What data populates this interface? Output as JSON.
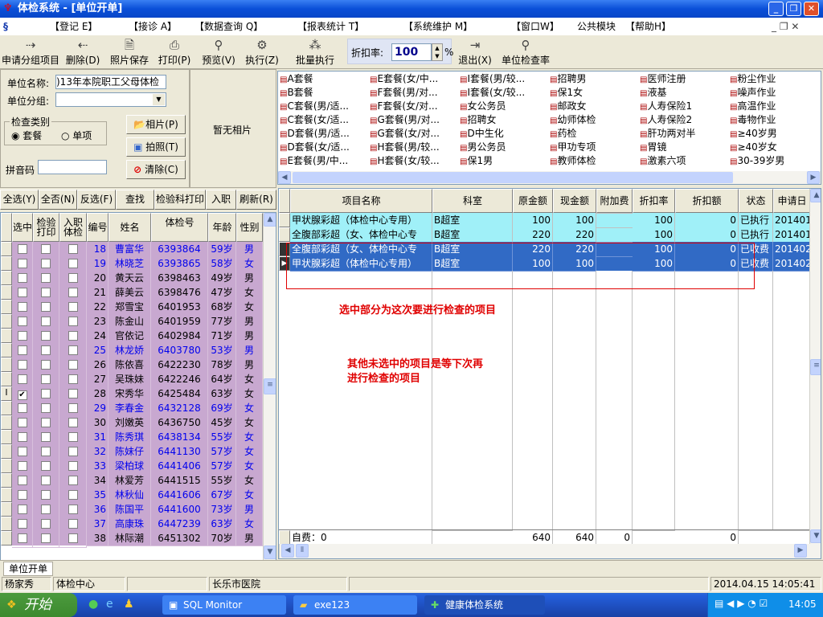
{
  "window": {
    "title": "体检系统 - [单位开单]"
  },
  "menu": [
    "【登记 E】",
    "【接诊 A】",
    "【数据查询 Q】",
    "【报表统计 T】",
    "【系统维护 M】",
    "【窗口W】",
    "公共模块",
    "【帮助H】"
  ],
  "toolbar": {
    "items": [
      {
        "label": "申请分组项目",
        "icon": "add-group-icon"
      },
      {
        "label": "删除(D)",
        "icon": "delete-icon"
      },
      {
        "label": "照片保存",
        "icon": "photo-save-icon"
      },
      {
        "label": "打印(P)",
        "icon": "printer-icon"
      },
      {
        "label": "预览(V)",
        "icon": "preview-icon"
      },
      {
        "label": "执行(Z)",
        "icon": "gear-icon"
      },
      {
        "label": "批量执行",
        "icon": "batch-icon"
      },
      {
        "label": "退出(X)",
        "icon": "exit-icon"
      },
      {
        "label": "单位检查率",
        "icon": "rate-icon"
      }
    ],
    "discount_label": "折扣率:",
    "discount_value": "100",
    "discount_unit": "%"
  },
  "form": {
    "unit_name_label": "单位名称:",
    "unit_name_value": ")13年本院职工父母体检",
    "unit_group_label": "单位分组:",
    "unit_group_value": "",
    "check_type_label": "检查类别",
    "radio_package": "套餐",
    "radio_single": "单项",
    "pinyin_label": "拼音码",
    "pinyin_value": "",
    "photo_button": "相片(P)",
    "capture_button": "拍照(T)",
    "clear_button": "清除(C)",
    "no_photo": "暂无相片"
  },
  "left_actions": [
    "全选(Y)",
    "全否(N)",
    "反选(F)",
    "查找",
    "检验科打印",
    "入职",
    "刷新(R)"
  ],
  "packages": [
    [
      "A套餐",
      "B套餐",
      "C套餐(男/适...",
      "C套餐(女/适...",
      "D套餐(男/适...",
      "D套餐(女/适...",
      "E套餐(男/中..."
    ],
    [
      "E套餐(女/中...",
      "F套餐(男/对...",
      "F套餐(女/对...",
      "G套餐(男/对...",
      "G套餐(女/对...",
      "H套餐(男/较...",
      "H套餐(女/较..."
    ],
    [
      "I套餐(男/较...",
      "I套餐(女/较...",
      "女公务员",
      "招聘女",
      "D中生化",
      "男公务员",
      "保1男"
    ],
    [
      "招聘男",
      "保1女",
      "邮政女",
      "幼师体检",
      "药检",
      "甲功专项",
      "教师体检"
    ],
    [
      "医师注册",
      "液基",
      "人寿保险1",
      "人寿保险2",
      "肝功两对半",
      "胃镜",
      "激素六项"
    ],
    [
      "粉尘作业",
      "噪声作业",
      "高温作业",
      "毒物作业",
      "≥40岁男",
      "≥40岁女",
      "30-39岁男"
    ]
  ],
  "people_grid": {
    "headers": [
      "选中",
      "检验打印",
      "入职体检",
      "编号",
      "姓名",
      "体检号",
      "年龄",
      "性别"
    ],
    "rows": [
      {
        "no": "18",
        "name": "曹富华",
        "id": "6393864",
        "age": "59岁",
        "sex": "男",
        "blue": true,
        "checked": false
      },
      {
        "no": "19",
        "name": "林晓芝",
        "id": "6393865",
        "age": "58岁",
        "sex": "女",
        "blue": true,
        "checked": false
      },
      {
        "no": "20",
        "name": "黄天云",
        "id": "6398463",
        "age": "49岁",
        "sex": "男",
        "blue": false,
        "checked": false
      },
      {
        "no": "21",
        "name": "薛美云",
        "id": "6398476",
        "age": "47岁",
        "sex": "女",
        "blue": false,
        "checked": false
      },
      {
        "no": "22",
        "name": "郑雪宝",
        "id": "6401953",
        "age": "68岁",
        "sex": "女",
        "blue": false,
        "checked": false
      },
      {
        "no": "23",
        "name": "陈金山",
        "id": "6401959",
        "age": "77岁",
        "sex": "男",
        "blue": false,
        "checked": false
      },
      {
        "no": "24",
        "name": "官依记",
        "id": "6402984",
        "age": "71岁",
        "sex": "男",
        "blue": false,
        "checked": false
      },
      {
        "no": "25",
        "name": "林龙娇",
        "id": "6403780",
        "age": "53岁",
        "sex": "男",
        "blue": true,
        "checked": false
      },
      {
        "no": "26",
        "name": "陈依喜",
        "id": "6422230",
        "age": "78岁",
        "sex": "男",
        "blue": false,
        "checked": false
      },
      {
        "no": "27",
        "name": "吴珠妹",
        "id": "6422246",
        "age": "64岁",
        "sex": "女",
        "blue": false,
        "checked": false
      },
      {
        "no": "28",
        "name": "宋秀华",
        "id": "6425484",
        "age": "63岁",
        "sex": "女",
        "blue": false,
        "checked": true
      },
      {
        "no": "29",
        "name": "李春金",
        "id": "6432128",
        "age": "69岁",
        "sex": "女",
        "blue": true,
        "checked": false
      },
      {
        "no": "30",
        "name": "刘嫩英",
        "id": "6436750",
        "age": "45岁",
        "sex": "女",
        "blue": false,
        "checked": false
      },
      {
        "no": "31",
        "name": "陈秀琪",
        "id": "6438134",
        "age": "55岁",
        "sex": "女",
        "blue": true,
        "checked": false
      },
      {
        "no": "32",
        "name": "陈妹仔",
        "id": "6441130",
        "age": "57岁",
        "sex": "女",
        "blue": true,
        "checked": false
      },
      {
        "no": "33",
        "name": "梁柏球",
        "id": "6441406",
        "age": "57岁",
        "sex": "女",
        "blue": true,
        "checked": false
      },
      {
        "no": "34",
        "name": "林爱芳",
        "id": "6441515",
        "age": "55岁",
        "sex": "女",
        "blue": false,
        "checked": false
      },
      {
        "no": "35",
        "name": "林秋仙",
        "id": "6441606",
        "age": "67岁",
        "sex": "女",
        "blue": true,
        "checked": false
      },
      {
        "no": "36",
        "name": "陈国平",
        "id": "6441600",
        "age": "73岁",
        "sex": "男",
        "blue": true,
        "checked": false
      },
      {
        "no": "37",
        "name": "高康珠",
        "id": "6447239",
        "age": "63岁",
        "sex": "女",
        "blue": true,
        "checked": false
      },
      {
        "no": "38",
        "name": "林际潮",
        "id": "6451302",
        "age": "70岁",
        "sex": "男",
        "blue": false,
        "checked": false
      }
    ]
  },
  "items_grid": {
    "headers": [
      "项目名称",
      "科室",
      "原金额",
      "现金额",
      "附加费",
      "折扣率",
      "折扣额",
      "状态",
      "申请日"
    ],
    "rows": [
      {
        "cells": [
          "甲状腺彩超（体检中心专用）",
          "B超室",
          "100",
          "100",
          "",
          "100",
          "0",
          "已执行",
          "201401"
        ],
        "state": "done"
      },
      {
        "cells": [
          "全腹部彩超（女、体检中心专",
          "B超室",
          "220",
          "220",
          "",
          "100",
          "0",
          "已执行",
          "201401"
        ],
        "state": "done"
      },
      {
        "cells": [
          "全腹部彩超（女、体检中心专",
          "B超室",
          "220",
          "220",
          "",
          "100",
          "0",
          "已收费",
          "201402"
        ],
        "state": "selected"
      },
      {
        "cells": [
          "甲状腺彩超（体检中心专用）",
          "B超室",
          "100",
          "100",
          "",
          "100",
          "0",
          "已收费",
          "201402"
        ],
        "state": "selected"
      }
    ],
    "footer": [
      "自费：0",
      "",
      "640",
      "640",
      "0",
      "",
      "0",
      "",
      ""
    ]
  },
  "annotations": {
    "note1": "选中部分为这次要进行检查的项目",
    "note2": "其他未选中的项目是等下次再进行检查的项目",
    "color": "#e00000"
  },
  "tab": "单位开单",
  "status": [
    "杨家秀",
    "体检中心",
    "",
    "长乐市医院",
    "",
    "2014.04.15 14:05:41"
  ],
  "taskbar": {
    "start": "开始",
    "tasks": [
      "SQL Monitor",
      "exe123",
      "健康体检系统"
    ],
    "clock": "14:05"
  },
  "colors": {
    "person_row": "#c8a8d0",
    "person_blue": "#0000ee",
    "done_row": "#a0f0f8",
    "selected_row": "#316ac5"
  }
}
